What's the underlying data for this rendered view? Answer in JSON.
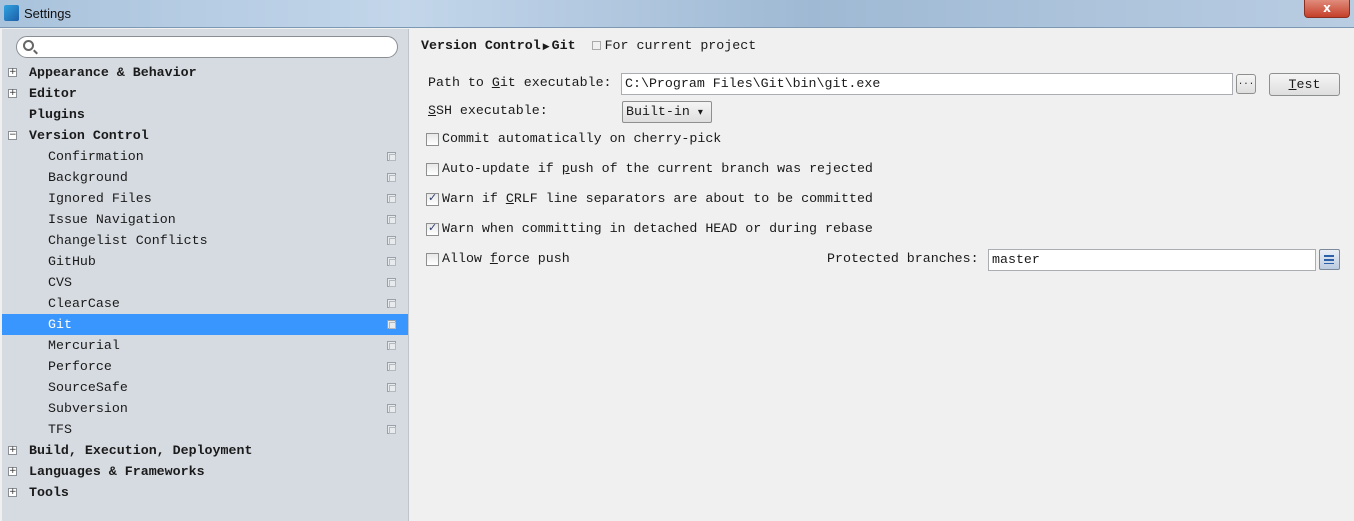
{
  "window": {
    "title": "Settings",
    "close_label": "x"
  },
  "sidebar": {
    "search_placeholder": "",
    "items": [
      {
        "label": "Appearance & Behavior",
        "level": 0,
        "expander": "+"
      },
      {
        "label": "Editor",
        "level": 0,
        "expander": "+"
      },
      {
        "label": "Plugins",
        "level": 0,
        "expander": ""
      },
      {
        "label": "Version Control",
        "level": 0,
        "expander": "−"
      },
      {
        "label": "Confirmation",
        "level": 1
      },
      {
        "label": "Background",
        "level": 1
      },
      {
        "label": "Ignored Files",
        "level": 1
      },
      {
        "label": "Issue Navigation",
        "level": 1
      },
      {
        "label": "Changelist Conflicts",
        "level": 1
      },
      {
        "label": "GitHub",
        "level": 1
      },
      {
        "label": "CVS",
        "level": 1
      },
      {
        "label": "ClearCase",
        "level": 1
      },
      {
        "label": "Git",
        "level": 1,
        "selected": true
      },
      {
        "label": "Mercurial",
        "level": 1
      },
      {
        "label": "Perforce",
        "level": 1
      },
      {
        "label": "SourceSafe",
        "level": 1
      },
      {
        "label": "Subversion",
        "level": 1
      },
      {
        "label": "TFS",
        "level": 1
      },
      {
        "label": "Build, Execution, Deployment",
        "level": 0,
        "expander": "+"
      },
      {
        "label": "Languages & Frameworks",
        "level": 0,
        "expander": "+"
      },
      {
        "label": "Tools",
        "level": 0,
        "expander": "+"
      }
    ]
  },
  "main": {
    "breadcrumb": {
      "parent": "Version Control",
      "arrow": "▶",
      "current": "Git",
      "scope": "For current project"
    },
    "git_path": {
      "pre": "Path to ",
      "key": "G",
      "post": "it executable:",
      "value": "C:\\Program Files\\Git\\bin\\git.exe",
      "browse": "...",
      "test_key": "T",
      "test_post": "est"
    },
    "ssh": {
      "key": "S",
      "post": "SH executable:",
      "value": "Built-in",
      "arrow": "▾"
    },
    "checkboxes": [
      {
        "pre": "Commit automatically on cherry-pick",
        "key": "",
        "post": "",
        "checked": false
      },
      {
        "pre": "Auto-update if ",
        "key": "p",
        "post": "ush of the current branch was rejected",
        "checked": false
      },
      {
        "pre": "Warn if ",
        "key": "C",
        "post": "RLF line separators are about to be committed",
        "checked": true
      },
      {
        "pre": "Warn when committing in detached HEAD or during rebase",
        "key": "",
        "post": "",
        "checked": true
      },
      {
        "pre": "Allow ",
        "key": "f",
        "post": "orce push",
        "checked": false
      }
    ],
    "protected": {
      "label": "Protected branches:",
      "value": "master"
    }
  },
  "colors": {
    "selection": "#3a96ff",
    "sidebar_bg": "#d6dbe1",
    "panel_bg": "#f0f0f0"
  }
}
